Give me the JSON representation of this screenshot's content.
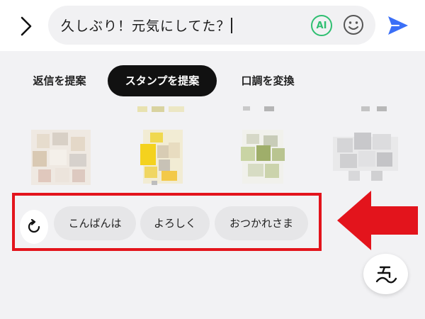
{
  "input": {
    "text": "久しぶり！元気にしてた？"
  },
  "toolbar": {
    "ai_label": "AI"
  },
  "tabs": [
    {
      "label": "返信を提案",
      "active": false
    },
    {
      "label": "スタンプを提案",
      "active": true
    },
    {
      "label": "口調を変換",
      "active": false
    }
  ],
  "suggestions": [
    "こんばんは",
    "よろしく",
    "おつかれさま"
  ],
  "icons": {
    "back": "chevron-right-icon",
    "ai": "ai-icon",
    "emoji": "smiley-icon",
    "send": "send-icon",
    "refresh": "refresh-icon",
    "fab": "sticker-icon"
  },
  "colors": {
    "accent_green": "#2fbf71",
    "send_blue": "#3a6ff7",
    "highlight_red": "#e3141c",
    "active_tab": "#111111"
  }
}
